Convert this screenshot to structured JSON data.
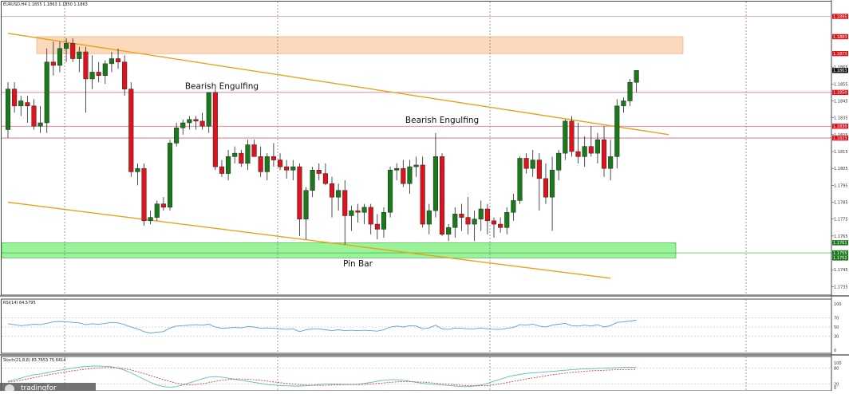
{
  "header": {
    "symbol_info": "EURUSD,H4  1.1855 1.1863 1.1850 1.1863"
  },
  "colors": {
    "bull": "#1a7a1a",
    "bear": "#e0121b",
    "resistance_zone": "#fcd9bd",
    "support_zone": "#9af29a",
    "trendline": "#e8a317",
    "hline": "#d6607a",
    "rsi_line": "#5aa0d8",
    "stoch_main": "#5abfbf",
    "stoch_signal": "#cc3333"
  },
  "chart_data": [
    {
      "type": "candlestick",
      "title": "EURUSD,H4",
      "ohlc_header": "1.1855 1.1863 1.1850 1.1863",
      "ylim": [
        1.173,
        1.19
      ],
      "y_ticks": [
        "1.1865",
        "1.1855",
        "1.1845",
        "1.1835",
        "1.1825",
        "1.1815",
        "1.1805",
        "1.1795",
        "1.1785",
        "1.1775",
        "1.1765",
        "1.1755",
        "1.1745",
        "1.1735"
      ],
      "price_badges": [
        {
          "value": 1.1895,
          "label": "1.1895",
          "color": "#e0121b"
        },
        {
          "value": 1.1883,
          "label": "1.1883",
          "color": "#e0121b"
        },
        {
          "value": 1.1873,
          "label": "1.1873",
          "color": "#e0121b"
        },
        {
          "value": 1.1863,
          "label": "1.1863",
          "color": "#111111"
        },
        {
          "value": 1.185,
          "label": "1.1850",
          "color": "#e0121b"
        },
        {
          "value": 1.183,
          "label": "1.1830",
          "color": "#e0121b"
        },
        {
          "value": 1.1823,
          "label": "1.1823",
          "color": "#e0121b"
        },
        {
          "value": 1.1761,
          "label": "1.1761",
          "color": "#1a7a1a"
        },
        {
          "value": 1.1755,
          "label": "1.1755",
          "color": "#1a7a1a"
        },
        {
          "value": 1.1752,
          "label": "1.1752",
          "color": "#1a7a1a"
        }
      ],
      "hlines": [
        1.185,
        1.183,
        1.1823
      ],
      "resistance_zone": [
        1.1873,
        1.1883
      ],
      "support_zone": [
        1.1752,
        1.1761
      ],
      "trendlines": [
        {
          "from": [
            0,
            1.1885
          ],
          "to": [
            102,
            1.1825
          ]
        },
        {
          "from": [
            0,
            1.1785
          ],
          "to": [
            93,
            1.174
          ]
        }
      ],
      "annotations": [
        {
          "text": "Bearish Engulfing",
          "bar": 33,
          "price": 1.1852
        },
        {
          "text": "Bearish Engulfing",
          "bar": 67,
          "price": 1.1832
        },
        {
          "text": "Pin Bar",
          "bar": 54,
          "price": 1.1747
        }
      ],
      "bars": [
        [
          1.1828,
          1.1856,
          1.1823,
          1.1852
        ],
        [
          1.1852,
          1.1856,
          1.1838,
          1.1842
        ],
        [
          1.1842,
          1.1848,
          1.1836,
          1.1845
        ],
        [
          1.1844,
          1.1848,
          1.1832,
          1.1842
        ],
        [
          1.1842,
          1.1846,
          1.1828,
          1.183
        ],
        [
          1.183,
          1.1842,
          1.1826,
          1.1832
        ],
        [
          1.1832,
          1.1876,
          1.1826,
          1.1868
        ],
        [
          1.1868,
          1.188,
          1.186,
          1.1866
        ],
        [
          1.1866,
          1.188,
          1.1862,
          1.1876
        ],
        [
          1.1876,
          1.1882,
          1.1868,
          1.1879
        ],
        [
          1.1879,
          1.1882,
          1.1868,
          1.187
        ],
        [
          1.187,
          1.1877,
          1.1862,
          1.1874
        ],
        [
          1.1874,
          1.1877,
          1.1838,
          1.1858
        ],
        [
          1.1858,
          1.1872,
          1.1852,
          1.1862
        ],
        [
          1.1862,
          1.1868,
          1.1856,
          1.186
        ],
        [
          1.186,
          1.1869,
          1.1855,
          1.1867
        ],
        [
          1.1867,
          1.1874,
          1.1862,
          1.187
        ],
        [
          1.187,
          1.1876,
          1.1864,
          1.1868
        ],
        [
          1.1868,
          1.1872,
          1.1848,
          1.1852
        ],
        [
          1.1852,
          1.1856,
          1.18,
          1.1803
        ],
        [
          1.1803,
          1.1808,
          1.1795,
          1.1805
        ],
        [
          1.1805,
          1.1808,
          1.1771,
          1.1774
        ],
        [
          1.1774,
          1.178,
          1.1772,
          1.1776
        ],
        [
          1.1776,
          1.1786,
          1.1774,
          1.1784
        ],
        [
          1.1784,
          1.1788,
          1.178,
          1.1782
        ],
        [
          1.1782,
          1.1822,
          1.178,
          1.182
        ],
        [
          1.182,
          1.1832,
          1.1818,
          1.1829
        ],
        [
          1.1829,
          1.1834,
          1.1825,
          1.1832
        ],
        [
          1.1832,
          1.1836,
          1.1828,
          1.1834
        ],
        [
          1.1834,
          1.1836,
          1.1828,
          1.1833
        ],
        [
          1.1833,
          1.1838,
          1.1828,
          1.183
        ],
        [
          1.183,
          1.185,
          1.1826,
          1.185
        ],
        [
          1.185,
          1.1852,
          1.1804,
          1.1806
        ],
        [
          1.1806,
          1.181,
          1.18,
          1.1802
        ],
        [
          1.1802,
          1.1816,
          1.1798,
          1.1812
        ],
        [
          1.1812,
          1.1818,
          1.1808,
          1.1814
        ],
        [
          1.1814,
          1.1816,
          1.1806,
          1.1808
        ],
        [
          1.1808,
          1.1822,
          1.1804,
          1.1819
        ],
        [
          1.1819,
          1.1822,
          1.1812,
          1.1812
        ],
        [
          1.1812,
          1.1818,
          1.18,
          1.1803
        ],
        [
          1.1803,
          1.1814,
          1.1798,
          1.1812
        ],
        [
          1.1812,
          1.182,
          1.1806,
          1.181
        ],
        [
          1.181,
          1.1814,
          1.1804,
          1.1806
        ],
        [
          1.1806,
          1.181,
          1.1799,
          1.1804
        ],
        [
          1.1804,
          1.181,
          1.1798,
          1.1806
        ],
        [
          1.1806,
          1.1808,
          1.1765,
          1.1775
        ],
        [
          1.1775,
          1.1794,
          1.1763,
          1.1792
        ],
        [
          1.1792,
          1.1806,
          1.1788,
          1.1804
        ],
        [
          1.1804,
          1.1808,
          1.1798,
          1.1802
        ],
        [
          1.1802,
          1.1808,
          1.1795,
          1.1796
        ],
        [
          1.1796,
          1.18,
          1.1776,
          1.1788
        ],
        [
          1.1788,
          1.1796,
          1.178,
          1.1792
        ],
        [
          1.1792,
          1.1798,
          1.176,
          1.1777
        ],
        [
          1.1777,
          1.1783,
          1.1768,
          1.178
        ],
        [
          1.178,
          1.1784,
          1.1773,
          1.1779
        ],
        [
          1.1779,
          1.1784,
          1.1772,
          1.1782
        ],
        [
          1.1782,
          1.1784,
          1.1766,
          1.1772
        ],
        [
          1.1772,
          1.1778,
          1.1763,
          1.1769
        ],
        [
          1.1769,
          1.1782,
          1.1764,
          1.1779
        ],
        [
          1.1779,
          1.1806,
          1.1776,
          1.1804
        ],
        [
          1.1804,
          1.1808,
          1.1798,
          1.1805
        ],
        [
          1.1805,
          1.181,
          1.1794,
          1.1796
        ],
        [
          1.1796,
          1.181,
          1.179,
          1.1806
        ],
        [
          1.1806,
          1.1812,
          1.18,
          1.1807
        ],
        [
          1.1807,
          1.1812,
          1.177,
          1.1772
        ],
        [
          1.1772,
          1.1784,
          1.1766,
          1.178
        ],
        [
          1.178,
          1.1826,
          1.1776,
          1.1812
        ],
        [
          1.1812,
          1.1814,
          1.1765,
          1.1766
        ],
        [
          1.1766,
          1.1772,
          1.1762,
          1.177
        ],
        [
          1.177,
          1.1782,
          1.1764,
          1.1778
        ],
        [
          1.1778,
          1.1784,
          1.1768,
          1.1776
        ],
        [
          1.1776,
          1.1788,
          1.1766,
          1.1772
        ],
        [
          1.1772,
          1.178,
          1.1762,
          1.1775
        ],
        [
          1.1775,
          1.1786,
          1.1768,
          1.1781
        ],
        [
          1.1781,
          1.1784,
          1.1766,
          1.1774
        ],
        [
          1.1774,
          1.1776,
          1.1764,
          1.1772
        ],
        [
          1.1772,
          1.1776,
          1.1767,
          1.177
        ],
        [
          1.177,
          1.1782,
          1.1766,
          1.1779
        ],
        [
          1.1779,
          1.179,
          1.1774,
          1.1786
        ],
        [
          1.1786,
          1.1812,
          1.1784,
          1.1811
        ],
        [
          1.1811,
          1.1814,
          1.1802,
          1.1805
        ],
        [
          1.1805,
          1.1816,
          1.18,
          1.181
        ],
        [
          1.181,
          1.1814,
          1.178,
          1.1799
        ],
        [
          1.1799,
          1.1808,
          1.1784,
          1.1788
        ],
        [
          1.1788,
          1.1812,
          1.1768,
          1.1804
        ],
        [
          1.1804,
          1.1816,
          1.1798,
          1.1814
        ],
        [
          1.1814,
          1.1834,
          1.181,
          1.1833
        ],
        [
          1.1833,
          1.1836,
          1.1812,
          1.1815
        ],
        [
          1.1815,
          1.1832,
          1.1808,
          1.1812
        ],
        [
          1.1812,
          1.1824,
          1.1806,
          1.1818
        ],
        [
          1.1818,
          1.183,
          1.1812,
          1.1814
        ],
        [
          1.1814,
          1.1826,
          1.1808,
          1.1822
        ],
        [
          1.1822,
          1.183,
          1.18,
          1.1805
        ],
        [
          1.1805,
          1.1822,
          1.1798,
          1.1812
        ],
        [
          1.1812,
          1.1846,
          1.1805,
          1.1842
        ],
        [
          1.1842,
          1.1847,
          1.1838,
          1.1845
        ],
        [
          1.1845,
          1.1858,
          1.1842,
          1.1856
        ],
        [
          1.1856,
          1.1863,
          1.185,
          1.1863
        ]
      ]
    },
    {
      "type": "line",
      "title": "RSI(14) 64.5795",
      "ylim": [
        0,
        100
      ],
      "y_ticks": [
        "100",
        "70",
        "50",
        "30",
        "0"
      ],
      "levels": [
        70,
        50,
        30
      ],
      "series": [
        {
          "name": "RSI(14)",
          "values": [
            57,
            55,
            53,
            54,
            56,
            55,
            58,
            61,
            62,
            61,
            60,
            59,
            55,
            57,
            56,
            58,
            60,
            59,
            55,
            50,
            46,
            40,
            37,
            39,
            40,
            48,
            52,
            53,
            54,
            55,
            54,
            56,
            50,
            47,
            48,
            49,
            48,
            51,
            50,
            47,
            48,
            47,
            46,
            45,
            46,
            40,
            44,
            46,
            46,
            44,
            42,
            44,
            42,
            43,
            42,
            43,
            42,
            41,
            44,
            50,
            52,
            50,
            53,
            52,
            46,
            48,
            54,
            46,
            45,
            48,
            47,
            46,
            46,
            48,
            46,
            45,
            45,
            47,
            49,
            55,
            54,
            56,
            52,
            50,
            54,
            56,
            58,
            53,
            52,
            54,
            52,
            55,
            50,
            53,
            60,
            61,
            63,
            64.58
          ]
        }
      ]
    },
    {
      "type": "line",
      "title": "Stoch(21,8,8) 83.7653 75.6414",
      "ylim": [
        0,
        100
      ],
      "y_ticks": [
        "100",
        "80",
        "20",
        "0"
      ],
      "levels": [
        80,
        20
      ],
      "series": [
        {
          "name": "Stoch(21,8,8)",
          "values": [
            30,
            35,
            42,
            50,
            55,
            58,
            62,
            68,
            72,
            76,
            80,
            84,
            86,
            88,
            88,
            87,
            85,
            80,
            72,
            62,
            50,
            38,
            26,
            16,
            10,
            8,
            10,
            16,
            24,
            32,
            40,
            46,
            48,
            46,
            42,
            38,
            34,
            30,
            26,
            22,
            18,
            16,
            14,
            13,
            12,
            12,
            13,
            15,
            18,
            20,
            20,
            19,
            18,
            18,
            19,
            22,
            26,
            30,
            34,
            36,
            36,
            34,
            30,
            26,
            22,
            20,
            18,
            16,
            14,
            12,
            10,
            10,
            12,
            16,
            22,
            30,
            38,
            46,
            52,
            56,
            60,
            62,
            64,
            66,
            68,
            70,
            72,
            74,
            76,
            77,
            78,
            79,
            80,
            81,
            82,
            83,
            83.5,
            83.77
          ]
        },
        {
          "name": "Stoch signal",
          "values": [
            28,
            30,
            34,
            39,
            44,
            49,
            54,
            58,
            62,
            66,
            70,
            73,
            76,
            79,
            81,
            82,
            82,
            81,
            78,
            73,
            67,
            60,
            52,
            44,
            36,
            29,
            23,
            19,
            17,
            18,
            21,
            25,
            30,
            34,
            37,
            39,
            39,
            38,
            36,
            34,
            31,
            28,
            25,
            22,
            20,
            18,
            16,
            15,
            15,
            15,
            16,
            17,
            18,
            18,
            18,
            19,
            20,
            22,
            24,
            26,
            28,
            29,
            29,
            28,
            27,
            25,
            23,
            21,
            19,
            17,
            15,
            14,
            13,
            13,
            14,
            17,
            21,
            25,
            30,
            34,
            39,
            43,
            47,
            51,
            55,
            58,
            61,
            64,
            66,
            68,
            70,
            71,
            72,
            73,
            74,
            74.5,
            75,
            75.64
          ]
        }
      ]
    }
  ],
  "footer": {
    "logo_text": "tradingfor"
  }
}
